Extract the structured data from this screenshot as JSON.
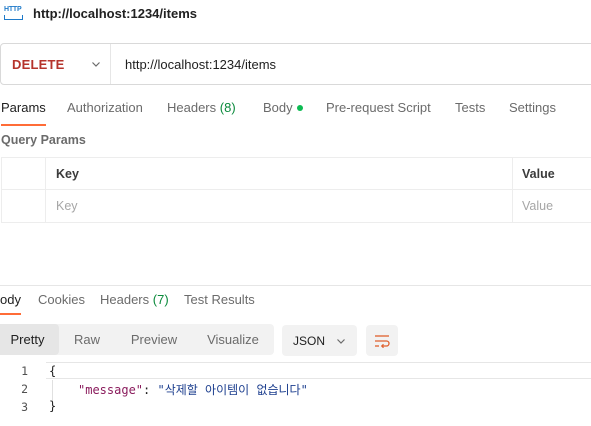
{
  "title": {
    "icon": "http-icon",
    "icon_text": "HTTP",
    "text": "http://localhost:1234/items"
  },
  "request": {
    "method": "DELETE",
    "url": "http://localhost:1234/items"
  },
  "request_tabs": [
    {
      "label": "Params",
      "active": true
    },
    {
      "label": "Authorization"
    },
    {
      "label": "Headers",
      "count": "(8)"
    },
    {
      "label": "Body",
      "indicator": "green-dot"
    },
    {
      "label": "Pre-request Script"
    },
    {
      "label": "Tests"
    },
    {
      "label": "Settings"
    }
  ],
  "query_params": {
    "label": "Query Params",
    "columns": [
      "Key",
      "Value"
    ],
    "placeholders": {
      "key": "Key",
      "value": "Value"
    }
  },
  "response_tabs": [
    {
      "label": "ody",
      "active": true
    },
    {
      "label": "Cookies"
    },
    {
      "label": "Headers",
      "count": "(7)"
    },
    {
      "label": "Test Results"
    }
  ],
  "view_modes": [
    {
      "label": "Pretty",
      "active": true
    },
    {
      "label": "Raw"
    },
    {
      "label": "Preview"
    },
    {
      "label": "Visualize"
    }
  ],
  "format": {
    "selected": "JSON"
  },
  "wrap_button": {
    "icon": "wrap-lines-icon"
  },
  "response_body": {
    "line_numbers": [
      "1",
      "2",
      "3"
    ],
    "open_brace": "{",
    "key": "\"message\"",
    "colon": ": ",
    "value": "\"삭제할 아이템이 없습니다\"",
    "close_brace": "}"
  },
  "colors": {
    "method_delete": "#b5332b",
    "active_tab_underline": "#ff6c37",
    "headers_count": "#0b8a3c",
    "body_dot": "#0cbb52",
    "json_key": "#8a1b5c",
    "json_string": "#1d3f8f"
  }
}
